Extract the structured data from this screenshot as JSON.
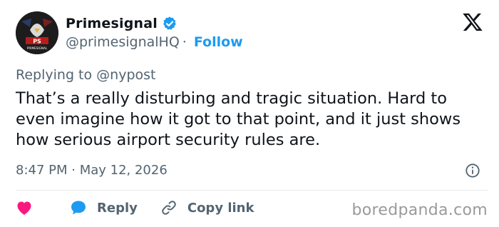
{
  "author": {
    "display_name": "Primesignal",
    "handle": "@primesignalHQ",
    "separator": "·",
    "follow_label": "Follow",
    "avatar_text": "PRIMESIGNAL",
    "verified": true
  },
  "reply": {
    "prefix": "Replying to",
    "mention": "@nypost"
  },
  "tweet": {
    "text": "That’s a really disturbing and tragic situation. Hard to even imagine how it got to that point, and it just shows how serious airport security rules are.",
    "timestamp": "8:47 PM · May 12, 2026"
  },
  "actions": {
    "reply_label": "Reply",
    "copy_link_label": "Copy link"
  },
  "watermark": "boredpanda.com",
  "icons": {
    "heart": "heart-icon",
    "reply": "speech-bubble-icon",
    "copy_link": "link-icon",
    "info": "info-icon",
    "logo": "x-logo-icon",
    "verified": "verified-badge-icon"
  },
  "colors": {
    "accent": "#1d9bf0",
    "heart": "#f91880",
    "muted": "#536471",
    "text": "#0f1419"
  }
}
